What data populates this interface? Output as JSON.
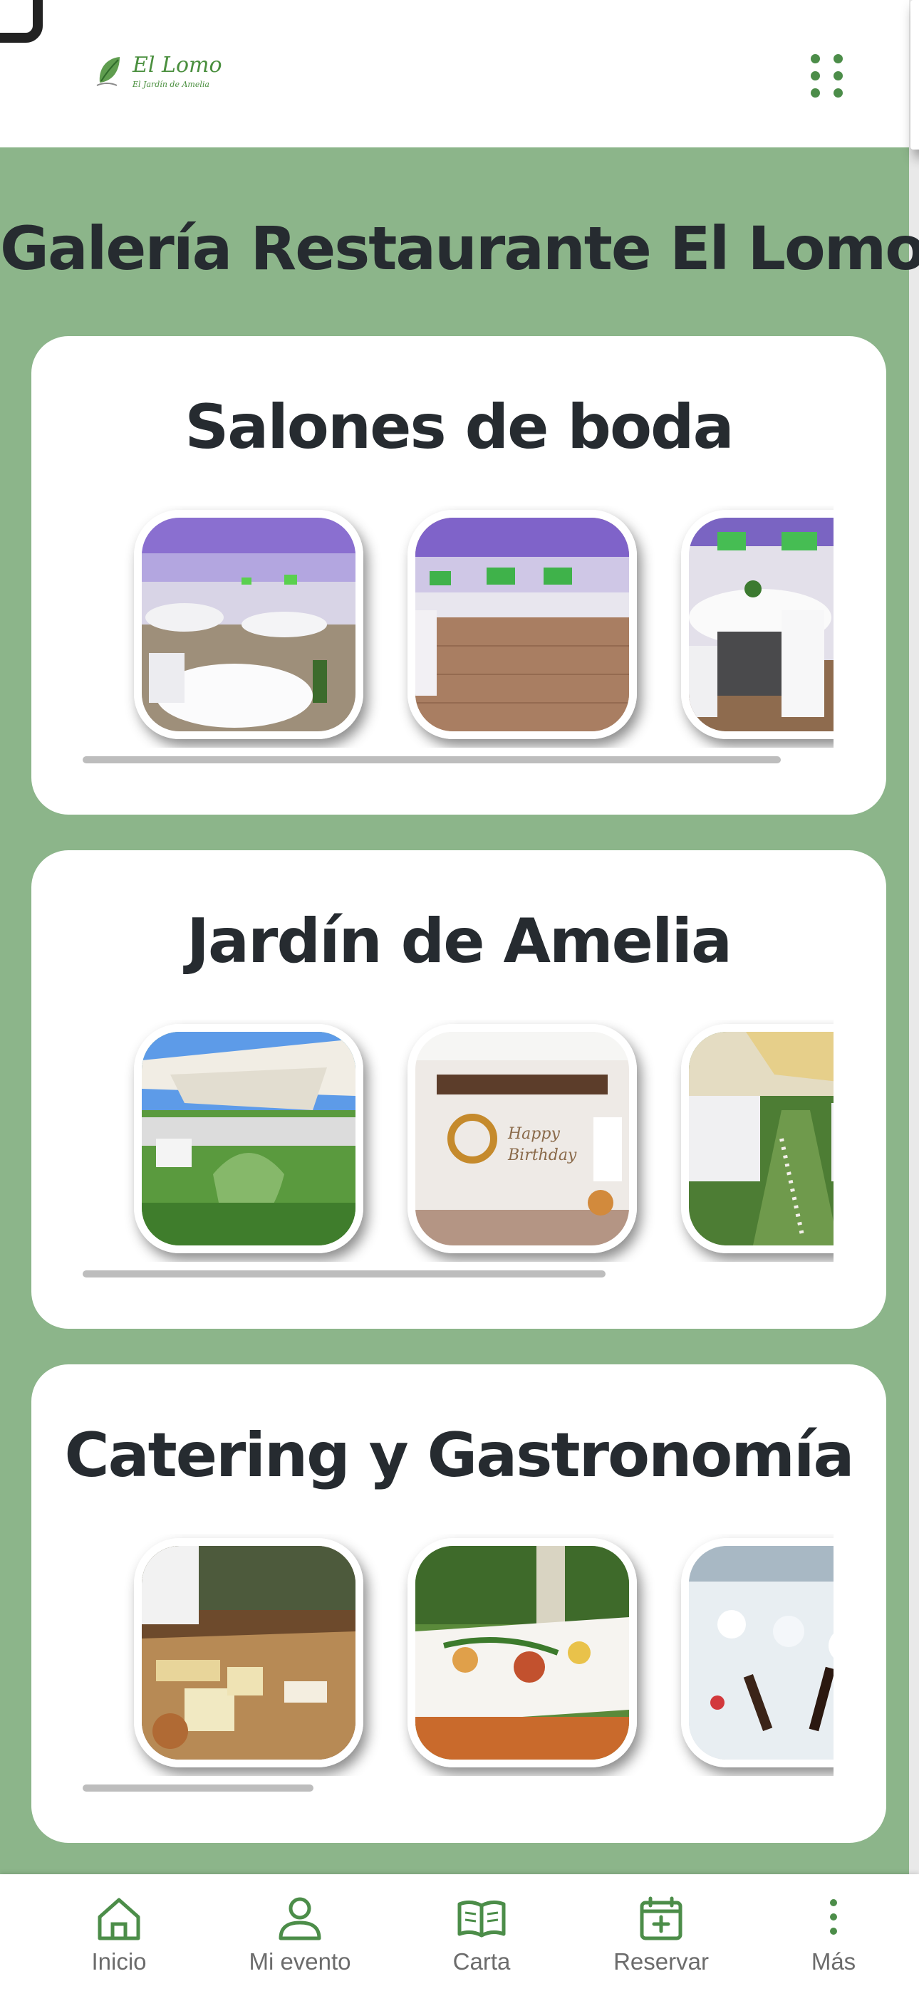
{
  "header": {
    "logo_title": "El Lomo",
    "logo_subtitle": "El Jardín de Amelia",
    "menu_icon": "grid-dots-icon"
  },
  "page": {
    "title": "Galería Restaurante El Lomo"
  },
  "galleries": [
    {
      "title": "Salones de boda",
      "photos": [
        "banquet-hall-photo",
        "dance-floor-photo",
        "round-table-photo"
      ],
      "scroll_fraction": 0.84
    },
    {
      "title": "Jardín de Amelia",
      "photos": [
        "garden-tables-photo",
        "birthday-wall-photo",
        "ceremony-aisle-photo"
      ],
      "scroll_fraction": 0.63
    },
    {
      "title": "Catering y Gastronomía",
      "photos": [
        "cheese-board-photo",
        "buffet-table-photo",
        "drinks-ice-photo"
      ],
      "scroll_fraction": 0.28
    }
  ],
  "bottom_nav": [
    {
      "label": "Inicio",
      "icon": "home-icon"
    },
    {
      "label": "Mi evento",
      "icon": "user-icon"
    },
    {
      "label": "Carta",
      "icon": "book-icon"
    },
    {
      "label": "Reservar",
      "icon": "calendar-plus-icon"
    },
    {
      "label": "Más",
      "icon": "more-vertical-icon"
    }
  ],
  "colors": {
    "background_green": "#8cb58a",
    "accent_green": "#4c8d49",
    "title_text": "#262b30",
    "nav_text": "#6c6c6c"
  }
}
